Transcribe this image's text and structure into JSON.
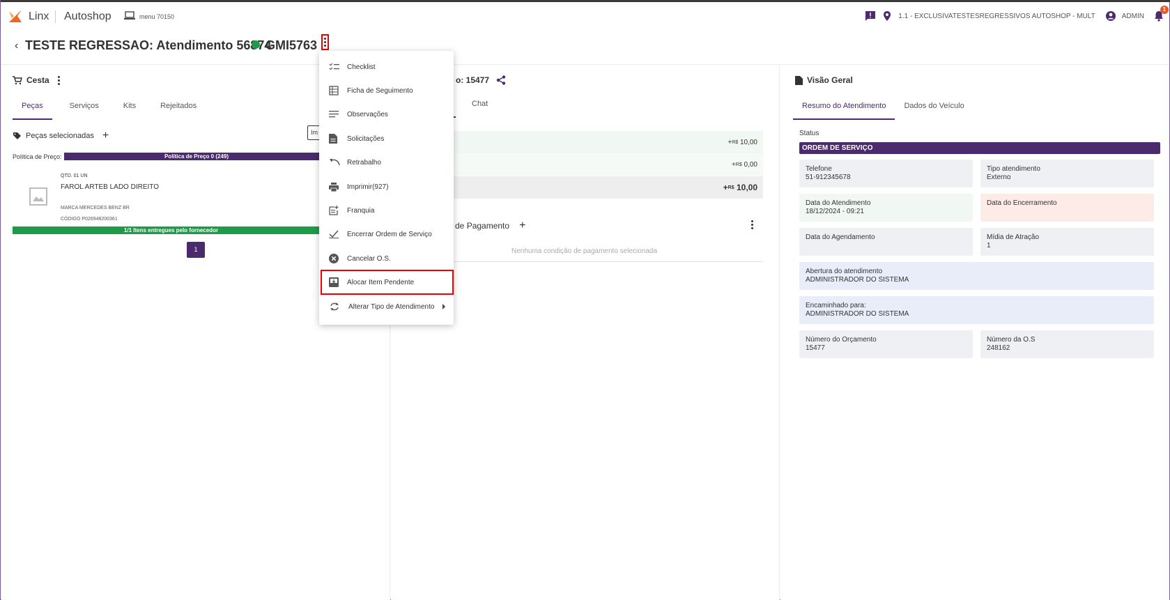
{
  "topbar": {
    "brand": "Linx",
    "app": "Autoshop",
    "menu": "menu 70150",
    "location": "1.1 - EXCLUSIVATESTESREGRESSIVOS AUTOSHOP - MULT",
    "user": "ADMIN",
    "notifications": "1"
  },
  "header": {
    "back": "‹",
    "title": "TESTE REGRESSAO: Atendimento 56874",
    "plate": "GMI5763"
  },
  "cesta": {
    "title": "Cesta",
    "tabs": [
      "Peças",
      "Serviços",
      "Kits",
      "Rejeitados"
    ],
    "selected_title": "Peças selecionadas",
    "import_btn": "Im",
    "policy_label": "Política de Preço:",
    "policy_value": "Política de Preço 0 (249)",
    "item": {
      "qtd": "QTD. 01 UN",
      "name": "FAROL ARTEB LADO DIREITO",
      "marca": "MARCA   MERCEDES BENZ BR",
      "codigo": "CÓDIGO   P026948200361"
    },
    "delivered": "1/1 Itens entregues pelo fornecedor",
    "page": "1"
  },
  "orcamento": {
    "title": "o: 15477",
    "tab_chat": "Chat",
    "rows": [
      {
        "currency": "R$",
        "value": "10,00"
      },
      {
        "currency": "R$",
        "value": "0,00"
      },
      {
        "currency": "R$",
        "value": "10,00"
      }
    ],
    "payment_title": "es de Pagamento",
    "payment_empty": "Nenhuma condição de pagamento selecionada"
  },
  "visao": {
    "title": "Visão Geral",
    "tabs": [
      "Resumo do Atendimento",
      "Dados do Veículo"
    ],
    "status_label": "Status",
    "status_value": "ORDEM DE SERVIÇO",
    "fields": {
      "telefone": {
        "label": "Telefone",
        "value": "51-912345678"
      },
      "tipo": {
        "label": "Tipo atendimento",
        "value": "Externo"
      },
      "data_atend": {
        "label": "Data do Atendimento",
        "value": "18/12/2024 - 09:21"
      },
      "data_enc": {
        "label": "Data do Encerramento",
        "value": ""
      },
      "data_agend": {
        "label": "Data do Agendamento",
        "value": ""
      },
      "midia": {
        "label": "Mídia de Atração",
        "value": "1"
      },
      "abertura": {
        "label": "Abertura do atendimento",
        "value": "ADMINISTRADOR DO SISTEMA"
      },
      "encaminhado": {
        "label": "Encaminhado para:",
        "value": "ADMINISTRADOR DO SISTEMA"
      },
      "num_orc": {
        "label": "Número do Orçamento",
        "value": "15477"
      },
      "num_os": {
        "label": "Número da O.S",
        "value": "248162"
      }
    }
  },
  "menu": {
    "items": [
      {
        "label": "Checklist",
        "icon": "checklist-icon"
      },
      {
        "label": "Ficha de Seguimento",
        "icon": "table-icon"
      },
      {
        "label": "Observações",
        "icon": "notes-icon"
      },
      {
        "label": "Solicitações",
        "icon": "document-icon"
      },
      {
        "label": "Retrabalho",
        "icon": "undo-icon"
      },
      {
        "label": "Imprimir(927)",
        "icon": "printer-icon"
      },
      {
        "label": "Franquia",
        "icon": "post-add-icon"
      },
      {
        "label": "Encerrar Ordem de Serviço",
        "icon": "check-icon"
      },
      {
        "label": "Cancelar O.S.",
        "icon": "cancel-icon"
      },
      {
        "label": "Alocar Item Pendente",
        "icon": "inbox-icon"
      },
      {
        "label": "Alterar Tipo de Atendimento",
        "icon": "sync-icon"
      }
    ]
  },
  "colors": {
    "primary": "#4b2a6e",
    "success": "#1e9b4a",
    "logo": "#f26522",
    "highlight": "#e00000"
  }
}
